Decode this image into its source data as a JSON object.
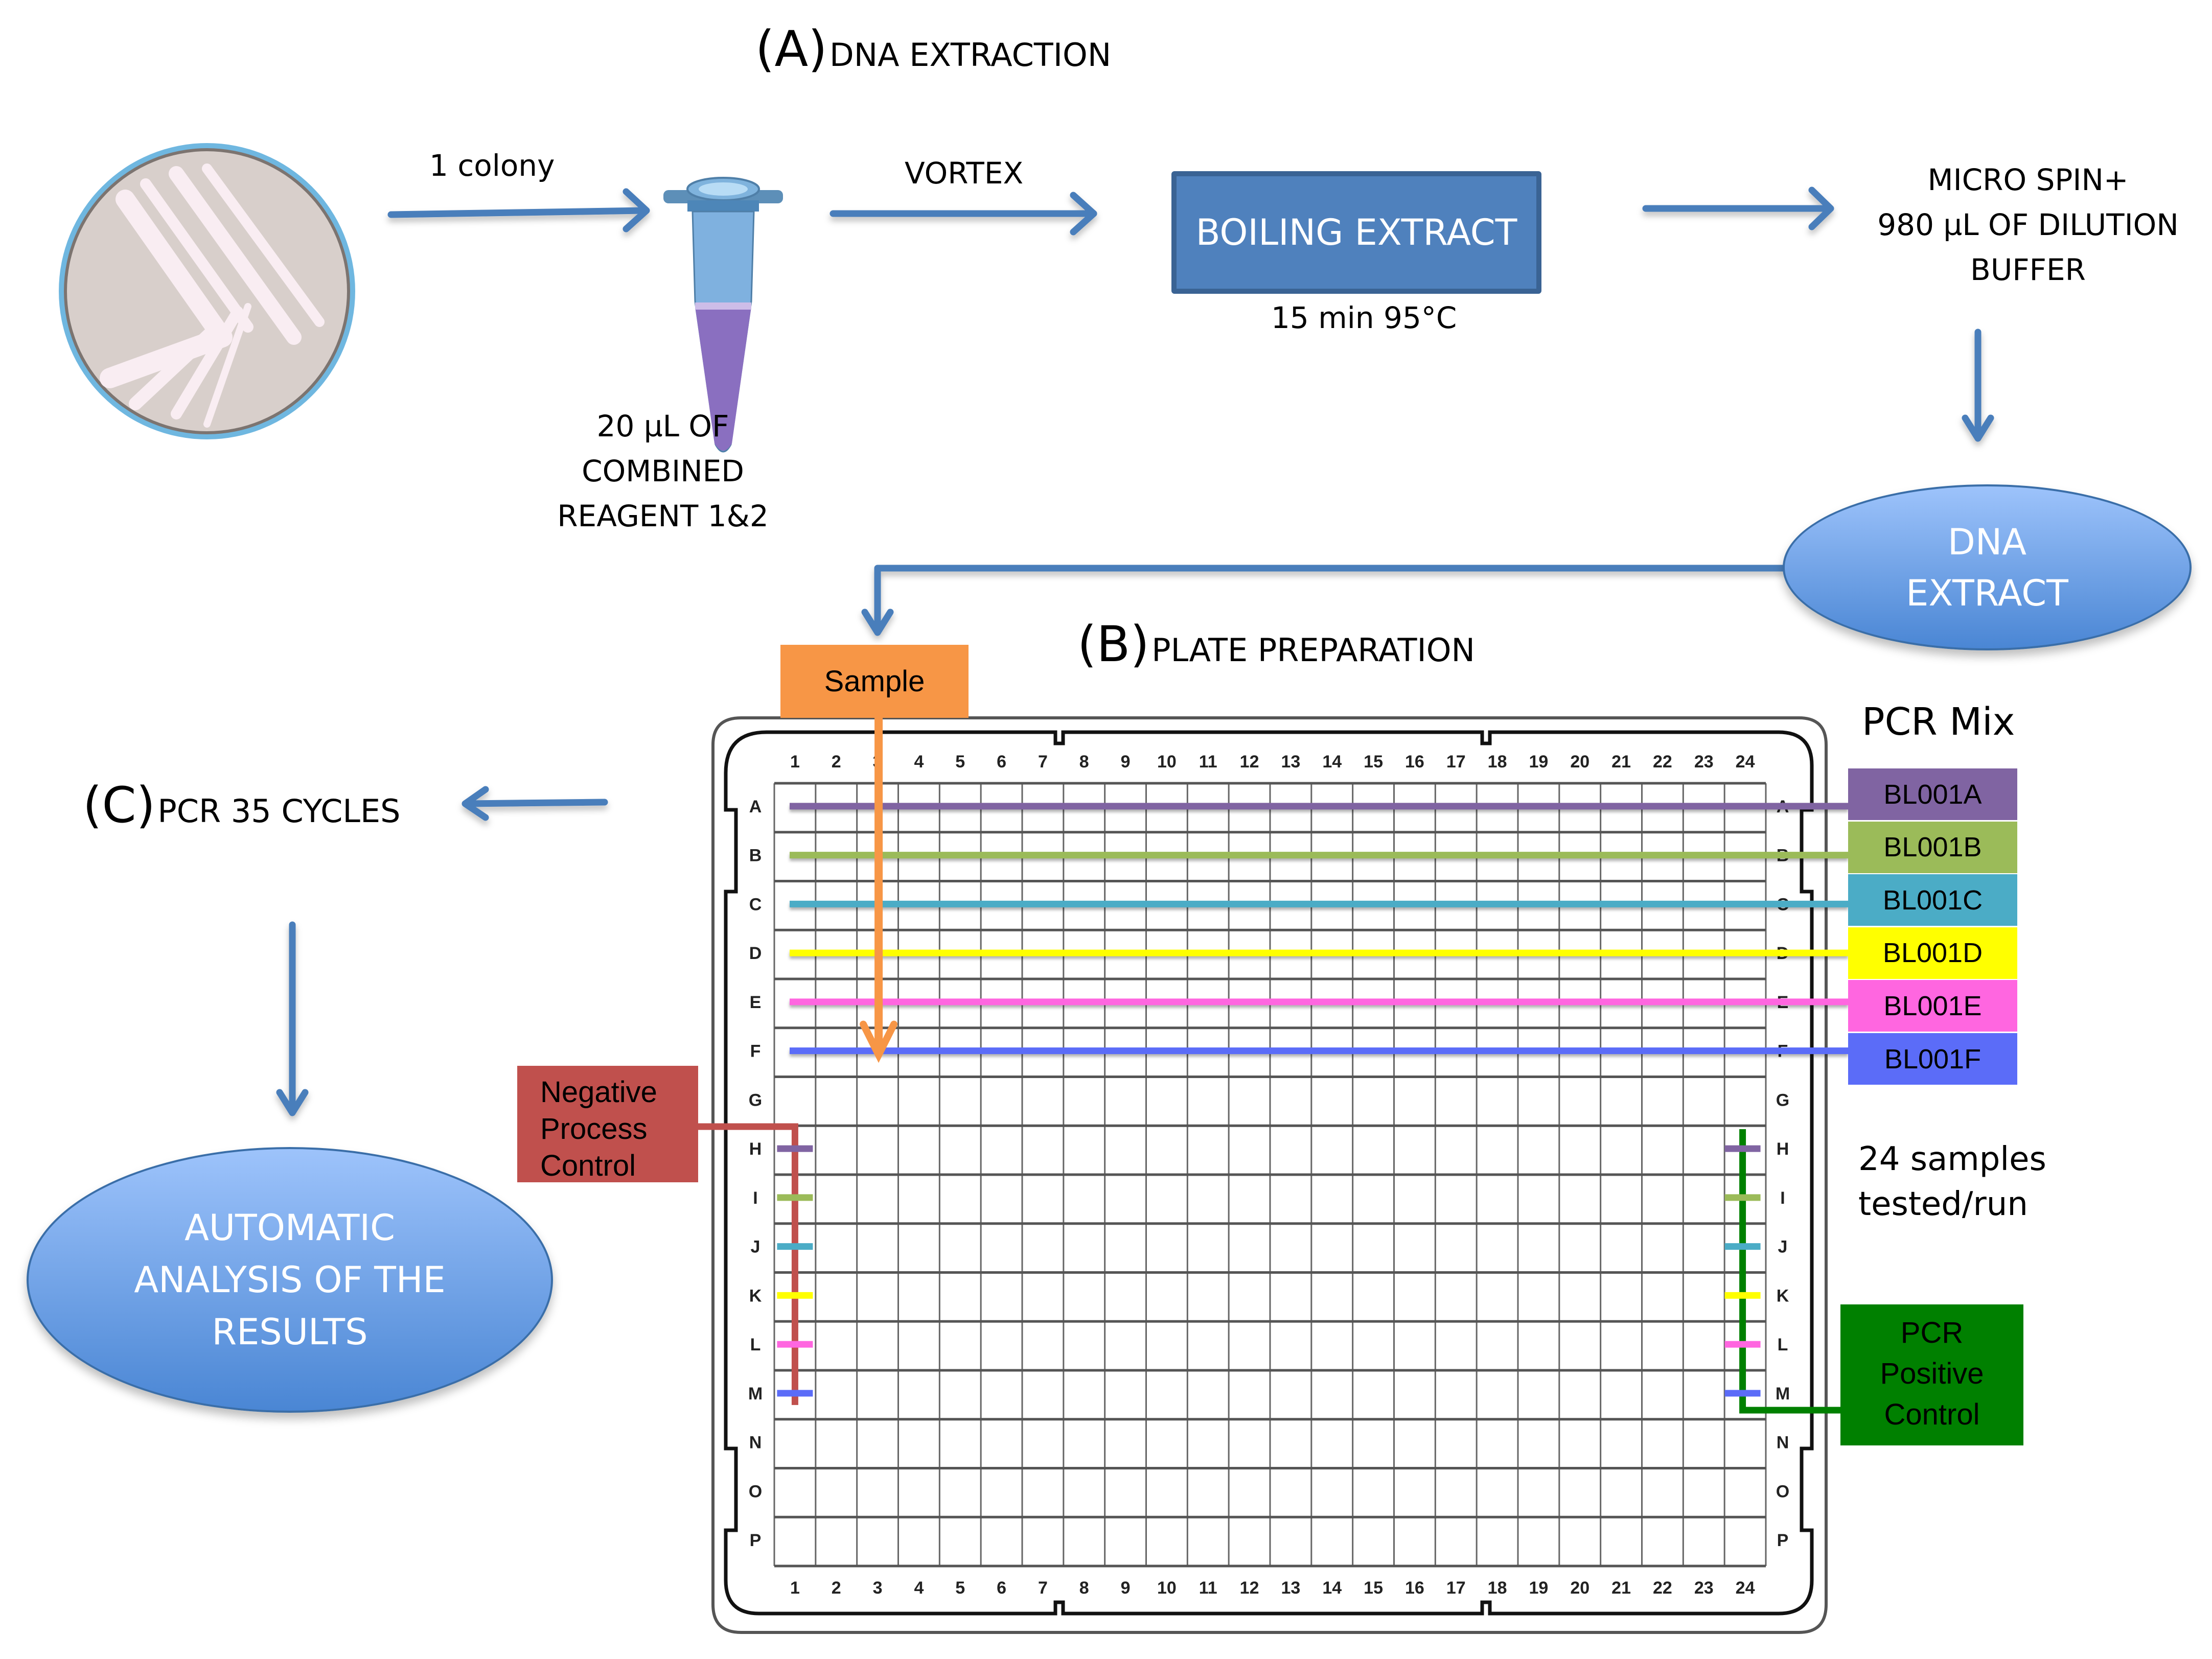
{
  "sections": {
    "a": {
      "letter": "(A)",
      "label": "DNA EXTRACTION"
    },
    "b": {
      "letter": "(B)",
      "label": "PLATE PREPARATION"
    },
    "c": {
      "letter": "(C)",
      "label": "PCR 35 CYCLES"
    }
  },
  "extraction": {
    "colony_label": "1 colony",
    "reagent_lines": [
      "20 µL OF",
      "COMBINED",
      "REAGENT 1&2"
    ],
    "vortex_label": "VORTEX",
    "boiling_label": "BOILING EXTRACT",
    "boiling_condition": "15 min 95°C",
    "spin_lines": [
      "MICRO SPIN+",
      "980 µL OF DILUTION",
      "BUFFER"
    ],
    "dna_extract_lines": [
      "DNA",
      "EXTRACT"
    ]
  },
  "plate": {
    "sample_label": "Sample",
    "columns": [
      "1",
      "2",
      "3",
      "4",
      "5",
      "6",
      "7",
      "8",
      "9",
      "10",
      "11",
      "12",
      "13",
      "14",
      "15",
      "16",
      "17",
      "18",
      "19",
      "20",
      "21",
      "22",
      "23",
      "24"
    ],
    "rows": [
      "A",
      "B",
      "C",
      "D",
      "E",
      "F",
      "G",
      "H",
      "I",
      "J",
      "K",
      "L",
      "M",
      "N",
      "O",
      "P"
    ],
    "sample_column": 3,
    "pcr_mix_title": "PCR Mix",
    "pcr_mix": [
      {
        "label": "BL001A",
        "color": "#8064a2",
        "row": "A",
        "control_row": "H"
      },
      {
        "label": "BL001B",
        "color": "#9bbb59",
        "row": "B",
        "control_row": "I"
      },
      {
        "label": "BL001C",
        "color": "#4bacc6",
        "row": "C",
        "control_row": "J"
      },
      {
        "label": "BL001D",
        "color": "#ffff00",
        "row": "D",
        "control_row": "K"
      },
      {
        "label": "BL001E",
        "color": "#ff66e0",
        "row": "E",
        "control_row": "L"
      },
      {
        "label": "BL001F",
        "color": "#5b6cf8",
        "row": "F",
        "control_row": "M"
      }
    ],
    "negative_control": {
      "lines": [
        "Negative",
        "Process",
        "Control"
      ],
      "column": 1,
      "color": "#c0504d"
    },
    "positive_control": {
      "lines": [
        "PCR",
        "Positive",
        "Control"
      ],
      "column": 24,
      "color": "#008000"
    },
    "throughput_lines": [
      "24 samples",
      "tested/run"
    ]
  },
  "analysis": {
    "lines": [
      "AUTOMATIC",
      "ANALYSIS OF THE",
      "RESULTS"
    ]
  },
  "colors": {
    "arrow": "#4a7ebb",
    "sample": "#f79646",
    "boiling_box": "#4f81bd"
  }
}
